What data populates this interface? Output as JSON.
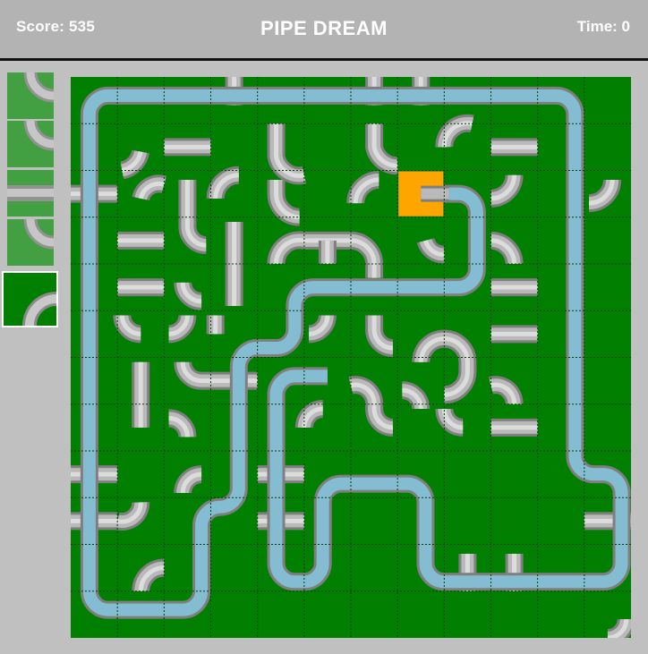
{
  "header": {
    "score_text": "Score: 535",
    "title": "PIPE DREAM",
    "time_text": "Time: 0"
  },
  "game": {
    "score": 535,
    "time": 0,
    "grid_cols": 12,
    "grid_rows": 12
  },
  "queue": [
    {
      "piece": "curve-bottom-left",
      "highlighted": false
    },
    {
      "piece": "curve-bottom-left",
      "highlighted": false
    },
    {
      "piece": "straight-horizontal",
      "highlighted": false
    },
    {
      "piece": "curve-top-right",
      "highlighted": false
    },
    {
      "piece": "curve-bottom-right",
      "highlighted": true
    }
  ],
  "cursor": {
    "col": 7,
    "row": 2
  },
  "colors": {
    "board": "#007f00",
    "grid_line": "#0a3d0a",
    "pipe": "#b9b9b9",
    "pipe_light": "#dcdcdc",
    "pipe_dark": "#7f7f7f",
    "water": "#84bdd2",
    "cursor": "#ffa500",
    "header": "#b3b3b3",
    "header_text": "#ffffff"
  },
  "icons": {
    "pipe_piece": "pipe-segment-icon",
    "cursor": "placement-cursor-icon"
  }
}
